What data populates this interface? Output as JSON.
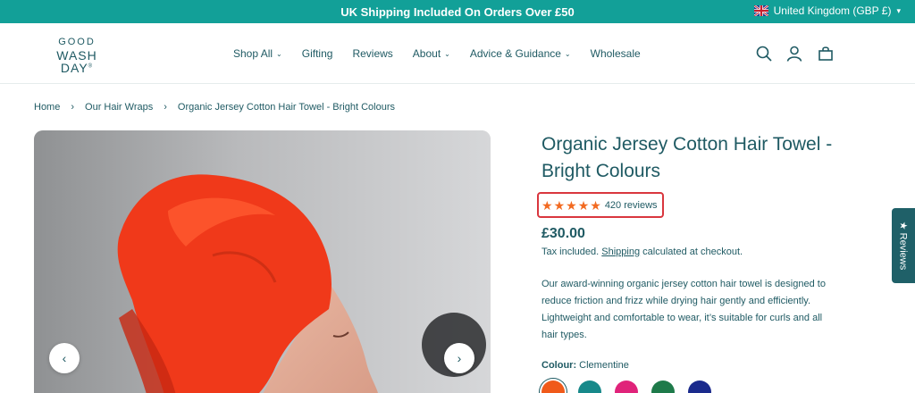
{
  "announcement": {
    "text": "UK Shipping Included On Orders Over £50"
  },
  "locale": {
    "label": "United Kingdom (GBP £)"
  },
  "logo": {
    "top": "GOOD",
    "bottom": "WASH DAY",
    "mark": "®"
  },
  "nav": {
    "items": [
      {
        "label": "Shop All",
        "dropdown": true
      },
      {
        "label": "Gifting",
        "dropdown": false
      },
      {
        "label": "Reviews",
        "dropdown": false
      },
      {
        "label": "About",
        "dropdown": true
      },
      {
        "label": "Advice & Guidance",
        "dropdown": true
      },
      {
        "label": "Wholesale",
        "dropdown": false
      }
    ]
  },
  "header_icons": [
    "search-icon",
    "account-icon",
    "cart-icon"
  ],
  "breadcrumb": [
    "Home",
    "Our Hair Wraps",
    "Organic Jersey Cotton Hair Towel - Bright Colours"
  ],
  "product": {
    "title": "Organic Jersey Cotton Hair Towel - Bright Colours",
    "rating": 5,
    "review_count": "420 reviews",
    "price": "£30.00",
    "tax_prefix": "Tax included.",
    "tax_link": "Shipping",
    "tax_suffix": "calculated at checkout.",
    "description": "Our award-winning organic jersey cotton hair towel is designed to reduce friction and frizz while drying hair gently and efficiently. Lightweight and comfortable to wear, it’s suitable for curls and all hair types.",
    "colour_label": "Colour:",
    "colour_value": "Clementine",
    "swatches": [
      "#f05a1a",
      "#17898a",
      "#e0237a",
      "#1e7a4a",
      "#1a2a8c"
    ]
  },
  "side_tab": {
    "label": "★ Reviews"
  },
  "colors": {
    "accent": "#12a098",
    "text": "#1f5a63",
    "star": "#f26a21",
    "highlight": "#d9363e"
  }
}
